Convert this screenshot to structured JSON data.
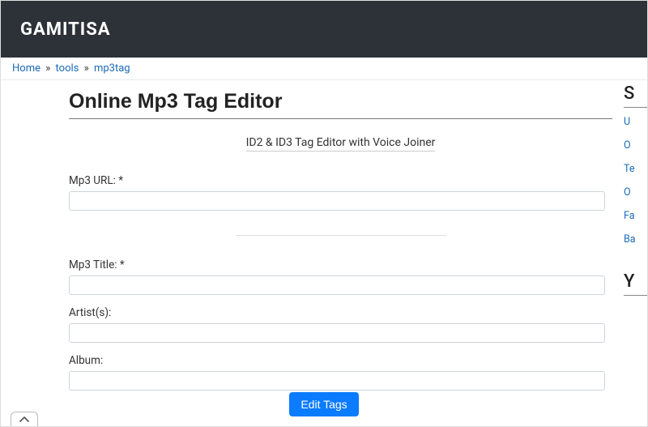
{
  "header": {
    "brand": "GAMITISA"
  },
  "breadcrumb": {
    "home": "Home",
    "sep1": "»",
    "tools": "tools",
    "sep2": "»",
    "mp3tag": "mp3tag"
  },
  "main": {
    "title": "Online Mp3 Tag Editor",
    "subtitle": "ID2 & ID3 Tag Editor with Voice Joiner",
    "labels": {
      "url": "Mp3 URL: *",
      "mp3title": "Mp3 Title: *",
      "artists": "Artist(s):",
      "album": "Album:"
    },
    "values": {
      "url": "",
      "mp3title": "",
      "artists": "",
      "album": ""
    },
    "edit_button": "Edit Tags"
  },
  "sidebar": {
    "heading1": "S",
    "links": [
      "U",
      "O",
      "Te",
      "O",
      "Fa",
      "Ba"
    ],
    "heading2": "Y"
  }
}
